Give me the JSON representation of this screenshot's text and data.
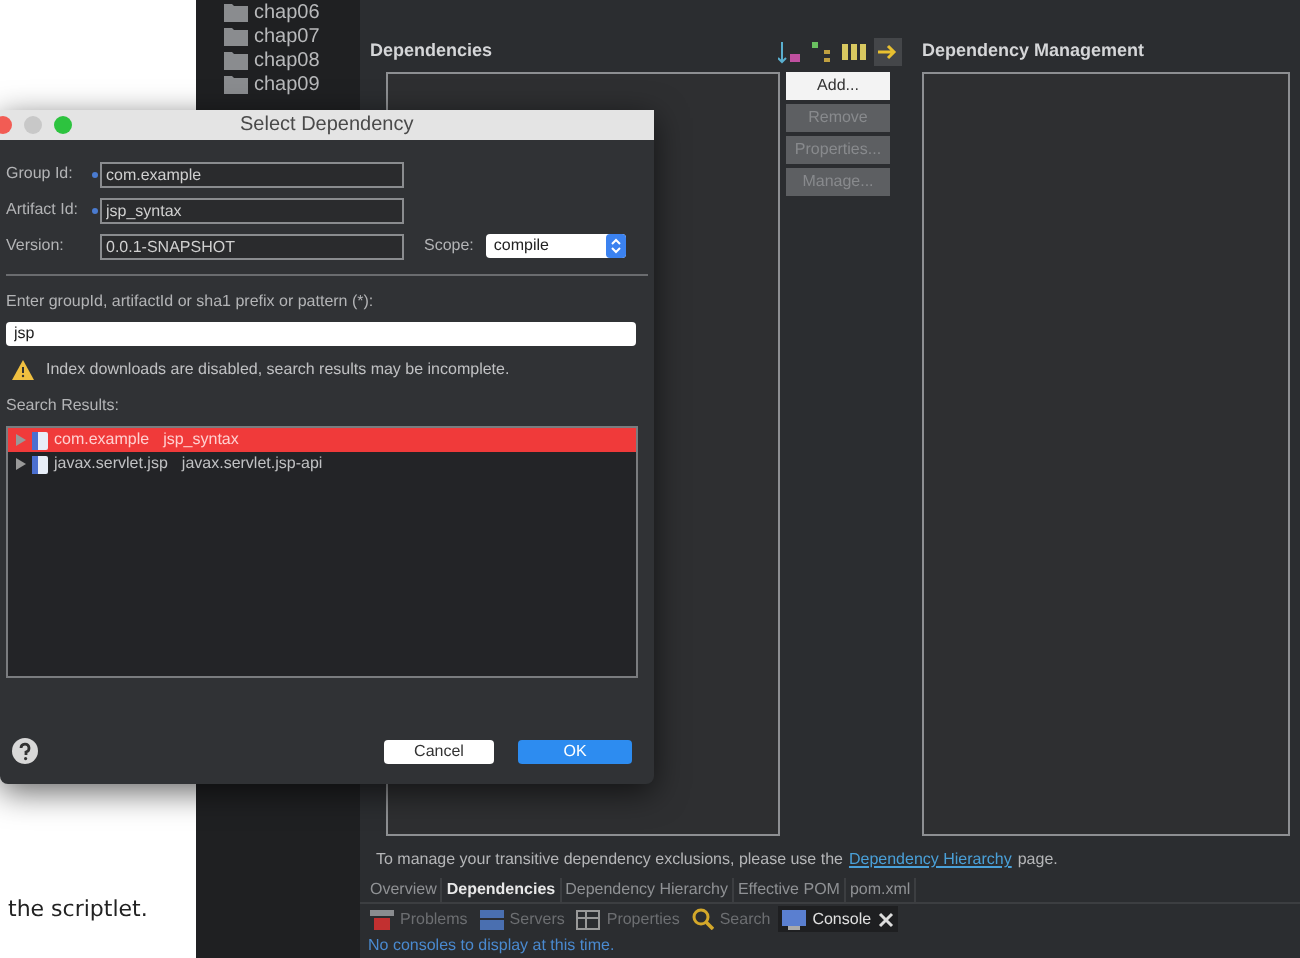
{
  "browser_page": {
    "text": "the scriptlet."
  },
  "project_tree": {
    "items": [
      "chap06",
      "chap07",
      "chap08",
      "chap09"
    ]
  },
  "editor": {
    "dependencies": {
      "title": "Dependencies",
      "buttons": [
        {
          "label": "Add...",
          "disabled": false
        },
        {
          "label": "Remove",
          "disabled": true
        },
        {
          "label": "Properties...",
          "disabled": true
        },
        {
          "label": "Manage...",
          "disabled": true
        }
      ]
    },
    "dependency_management": {
      "title": "Dependency Management"
    },
    "note": {
      "before": "To manage your transitive dependency exclusions, please use the",
      "link": "Dependency Hierarchy",
      "after": "page."
    },
    "tabs": [
      {
        "label": "Overview",
        "selected": false
      },
      {
        "label": "Dependencies",
        "selected": true
      },
      {
        "label": "Dependency Hierarchy",
        "selected": false
      },
      {
        "label": "Effective POM",
        "selected": false
      },
      {
        "label": "pom.xml",
        "selected": false
      }
    ],
    "views": [
      {
        "label": "Problems",
        "kind": "problems",
        "selected": false
      },
      {
        "label": "Servers",
        "kind": "servers",
        "selected": false
      },
      {
        "label": "Properties",
        "kind": "properties",
        "selected": false
      },
      {
        "label": "Search",
        "kind": "search",
        "selected": false
      },
      {
        "label": "Console",
        "kind": "console",
        "selected": true
      }
    ],
    "console_message": "No consoles to display at this time."
  },
  "dialog": {
    "title": "Select Dependency",
    "fields": [
      {
        "label": "Group Id:",
        "value": "com.example",
        "required": true
      },
      {
        "label": "Artifact Id:",
        "value": "jsp_syntax",
        "required": true
      },
      {
        "label": "Version:",
        "value": "0.0.1-SNAPSHOT",
        "required": false
      }
    ],
    "scope": {
      "label": "Scope:",
      "value": "compile"
    },
    "search": {
      "label": "Enter groupId, artifactId or sha1 prefix or pattern (*):",
      "value": "jsp"
    },
    "warning": "Index downloads are disabled, search results may be incomplete.",
    "results_label": "Search Results:",
    "results": [
      {
        "group": "com.example",
        "artifact": "jsp_syntax",
        "selected": true
      },
      {
        "group": "javax.servlet.jsp",
        "artifact": "javax.servlet.jsp-api",
        "selected": false
      }
    ],
    "buttons": [
      {
        "label": "Cancel",
        "default": false
      },
      {
        "label": "OK",
        "default": true
      }
    ]
  }
}
